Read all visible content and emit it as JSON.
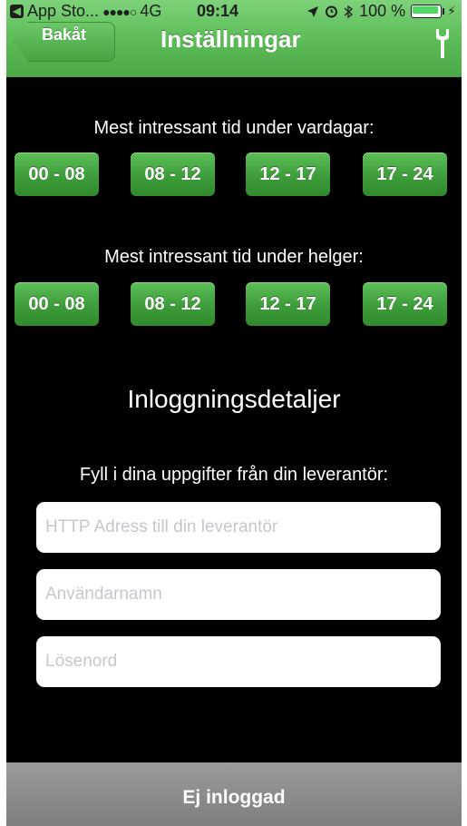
{
  "status_bar": {
    "back_app": "App Sto...",
    "signal": "●●●●○",
    "network": "4G",
    "time": "09:14",
    "icons": [
      "location-arrow-icon",
      "alarm-icon",
      "bluetooth-icon"
    ],
    "battery": "100 %",
    "battery_level": 1.0
  },
  "nav": {
    "back_label": "Bakåt",
    "title": "Inställningar",
    "tool_icon": "wrench-icon"
  },
  "weekdays": {
    "label": "Mest intressant tid under vardagar:",
    "slots": [
      "00 - 08",
      "08 - 12",
      "12 - 17",
      "17 - 24"
    ]
  },
  "weekends": {
    "label": "Mest intressant tid under helger:",
    "slots": [
      "00 - 08",
      "08 - 12",
      "12 - 17",
      "17 - 24"
    ]
  },
  "login": {
    "heading": "Inloggningsdetaljer",
    "instructions": "Fyll i dina uppgifter från din leverantör:",
    "http_placeholder": "HTTP Adress till din leverantör",
    "http_value": "",
    "username_placeholder": "Användarnamn",
    "username_value": "",
    "password_placeholder": "Lösenord",
    "password_value": ""
  },
  "footer": {
    "status": "Ej inloggad"
  },
  "colors": {
    "header_green": "#5fbf5b",
    "button_green": "#3e9c3a",
    "background": "#000000",
    "footer_gray": "#8a8a8a"
  }
}
